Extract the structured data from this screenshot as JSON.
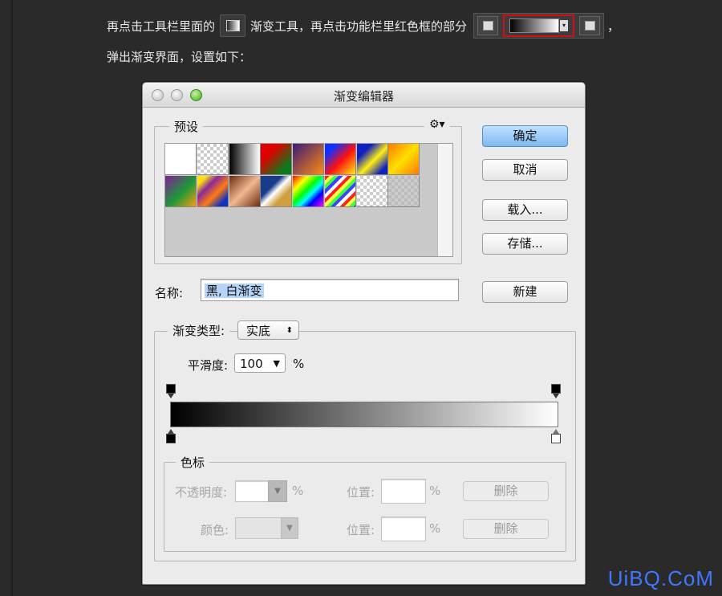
{
  "article": {
    "line1_part1": "再点击工具栏里面的",
    "line1_part2": "渐变工具，再点击功能栏里红色框的部分",
    "line1_tail": "，",
    "line2": "弹出渐变界面，设置如下："
  },
  "dialog": {
    "title": "渐变编辑器",
    "presets_label": "预设",
    "gear_icon": "gear-icon",
    "buttons": {
      "ok": "确定",
      "cancel": "取消",
      "load": "载入...",
      "save": "存储...",
      "new": "新建"
    },
    "name_label": "名称:",
    "name_value": "黑, 白渐变",
    "type_label": "渐变类型:",
    "type_value": "实底",
    "smooth_label": "平滑度:",
    "smooth_value": "100",
    "smooth_unit": "%",
    "stops_group_label": "色标",
    "opacity_label": "不透明度:",
    "opacity_unit": "%",
    "position_label_1": "位置:",
    "position_unit_1": "%",
    "delete_1": "删除",
    "color_label": "颜色:",
    "position_label_2": "位置:",
    "position_unit_2": "%",
    "delete_2": "删除"
  },
  "swatches": [
    "#ffffff",
    "transparent-check",
    "black-white",
    "red-green",
    "violet-orange",
    "blue-red-yellow",
    "blue-yellow-blue",
    "orange-yellow-orange",
    "violet-green-orange",
    "yellow-violet-orange-blue",
    "copper",
    "chrome",
    "spectrum",
    "transparent-rainbow",
    "transparent-stripes",
    "neutral-density"
  ],
  "gradient": {
    "start_color": "#000000",
    "end_color": "#ffffff"
  },
  "watermark": "UiBQ.CoM"
}
